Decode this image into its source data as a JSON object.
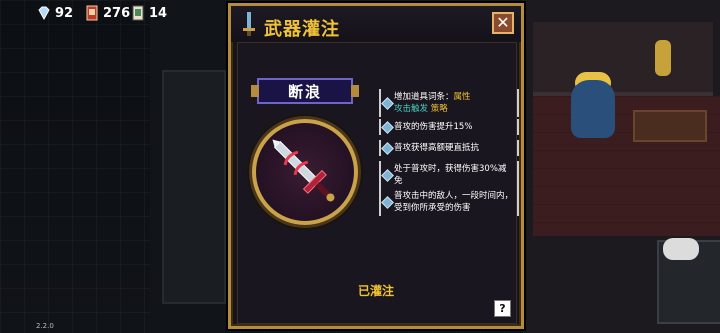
{
  "hud": {
    "gems": "92",
    "cards": "276",
    "tickets": "14"
  },
  "version": "2.2.0",
  "dialog": {
    "title": "武器灌注",
    "close_label": "✕",
    "weapon_name": "断浪",
    "bonuses": [
      {
        "prefix": "增加道具词条：",
        "highlight": "属性",
        "line2_a": "攻击触发",
        "line2_b": "策略"
      },
      {
        "text": "普攻的伤害提升15%"
      },
      {
        "text": "普攻获得高额硬直抵抗"
      },
      {
        "text": "处于普攻时，获得伤害30%减免"
      },
      {
        "text": "普攻击中的敌人，一段时间内，受到你所承受的伤害"
      }
    ],
    "status": "已灌注",
    "help_label": "?"
  },
  "colors": {
    "accent_gold": "#f1c232",
    "frame_gold": "#b58c3e",
    "teal": "#45d0c0",
    "panel_bg": "#17141c"
  }
}
